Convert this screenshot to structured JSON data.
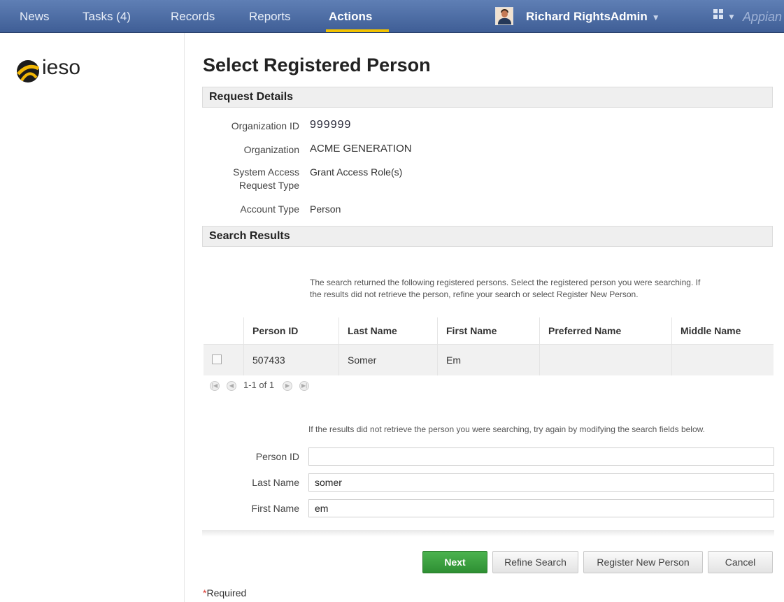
{
  "nav": {
    "items": [
      "News",
      "Tasks (4)",
      "Records",
      "Reports",
      "Actions"
    ],
    "active": "Actions",
    "user_name": "Richard RightsAdmin",
    "brand": "Appian"
  },
  "sidebar": {
    "logo_text": "ieso"
  },
  "page": {
    "title": "Select Registered Person"
  },
  "request_details": {
    "heading": "Request Details",
    "org_id_label": "Organization ID",
    "org_id": "999999",
    "org_label": "Organization",
    "org": "ACME GENERATION",
    "sys_label_1": "System Access",
    "sys_label_2": "Request Type",
    "sys_value": "Grant Access Role(s)",
    "acct_label": "Account Type",
    "acct_value": "Person"
  },
  "search_results": {
    "heading": "Search Results",
    "intro_1": "The search returned the following registered persons. Select the registered person you were searching. If",
    "intro_2": "the results did not retrieve the person, refine your search or select Register New Person.",
    "columns": [
      "",
      "Person ID",
      "Last Name",
      "First Name",
      "Preferred Name",
      "Middle Name"
    ],
    "rows": [
      {
        "person_id": "507433",
        "last_name": "Somer",
        "first_name": "Em",
        "preferred_name": "",
        "middle_name": ""
      }
    ],
    "pager": "1-1 of 1"
  },
  "refine": {
    "hint": "If the results did not retrieve the person you were searching, try again by modifying the search fields below.",
    "person_id_label": "Person ID",
    "person_id_value": "",
    "last_name_label": "Last Name",
    "last_name_value": "somer",
    "first_name_label": "First Name",
    "first_name_value": "em"
  },
  "buttons": {
    "next": "Next",
    "refine": "Refine Search",
    "register": "Register New Person",
    "cancel": "Cancel"
  },
  "required_note": "Required",
  "colors": {
    "nav": "#4f6fa8",
    "accent": "#f2c200",
    "primary_button": "#3b9f3f"
  }
}
